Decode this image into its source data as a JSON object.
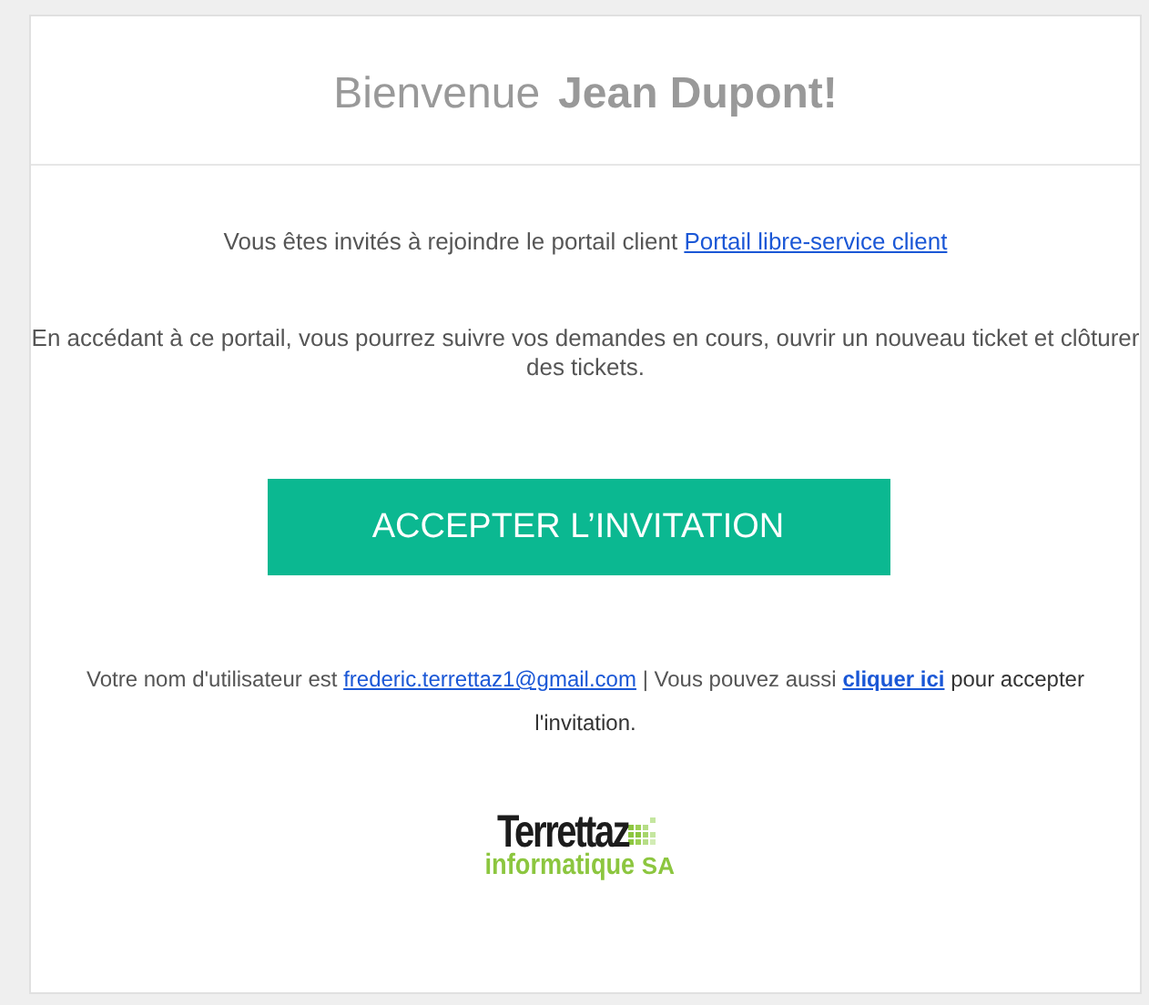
{
  "heading": {
    "greeting": "Bienvenue",
    "name": "Jean Dupont!"
  },
  "invite": {
    "text": "Vous êtes invités à rejoindre le portail client",
    "link": "Portail libre-service client"
  },
  "description": "En accédant à ce portail, vous pourrez suivre vos demandes en cours, ouvrir un nouveau ticket et clôturer des tickets.",
  "button": "ACCEPTER L’INVITATION",
  "footer": [
    {
      "kind": "text",
      "text": "Votre nom d'utilisateur est"
    },
    {
      "kind": "link",
      "text": "frederic.terrettaz1@gmail.com"
    },
    {
      "kind": "text",
      "text": "| Vous pouvez aussi"
    },
    {
      "kind": "strong-link",
      "text": "cliquer ici"
    },
    {
      "kind": "dark",
      "text": "pour accepter l'invitation."
    }
  ],
  "logo": {
    "line1": "Terrettaz",
    "line2": "informatique",
    "suffix": "SA"
  }
}
